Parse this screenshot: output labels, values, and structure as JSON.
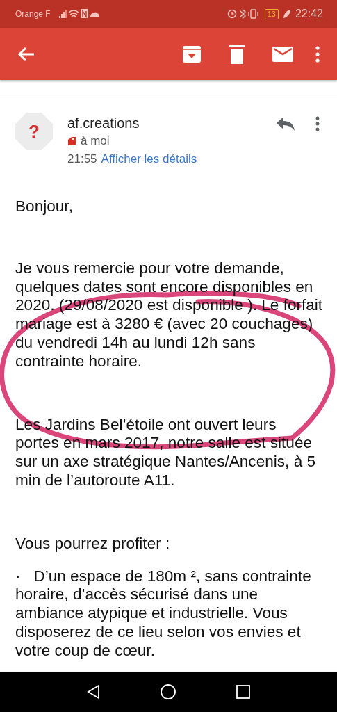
{
  "status_bar": {
    "carrier": "Orange F",
    "battery": "13",
    "time": "22:42"
  },
  "message": {
    "avatar": "?",
    "sender": "af.creations",
    "recipient": "à moi",
    "time": "21:55",
    "details_link": "Afficher les détails"
  },
  "body": [
    {
      "kind": "paragraph",
      "text": "Bonjour,"
    },
    {
      "kind": "paragraph",
      "text": "Je vous remercie pour votre demande, quelques dates sont encore disponibles en 2020. (29/08/2020 est disponible ). Le forfait mariage est à 3280 € (avec 20 couchages) du vendredi 14h au lundi 12h sans contrainte horaire."
    },
    {
      "kind": "paragraph",
      "text": "Les Jardins Bel’étoile ont ouvert leurs portes en mars 2017, notre salle est située sur un axe stratégique Nantes/Ancenis, à 5 min de l’autoroute A11."
    },
    {
      "kind": "heading",
      "text": "Vous pourrez profiter :"
    },
    {
      "kind": "bullet",
      "marker": "·",
      "text": "D’un espace de 180m ², sans contrainte horaire, d’accès sécurisé dans une ambiance atypique et industrielle. Vous disposerez de ce lieu selon vos envies et votre coup de cœur."
    }
  ]
}
